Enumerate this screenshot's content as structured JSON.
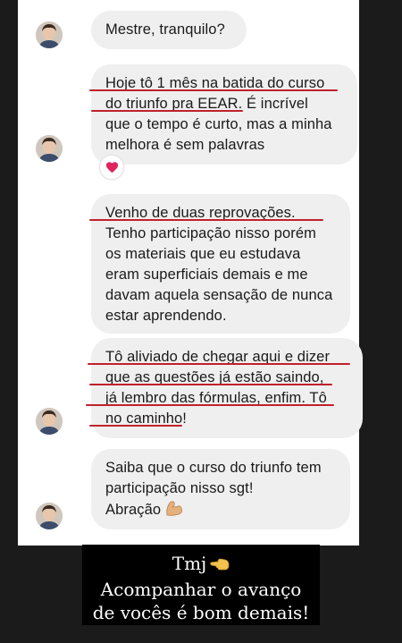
{
  "messages": [
    {
      "lines": [
        "Mestre, tranquilo?"
      ]
    },
    {
      "lines": [
        "Hoje tô 1 mês na batida do curso",
        "do triunfo pra EEAR. É incrível",
        "que o tempo é curto, mas a minha",
        "melhora é sem palavras"
      ],
      "reaction": "heart-icon"
    },
    {
      "lines": [
        "Venho de duas reprovações.",
        "Tenho participação nisso porém",
        "os materiais que eu estudava",
        "eram superficiais demais e me",
        "davam aquela sensação de nunca",
        "estar aprendendo."
      ]
    },
    {
      "lines": [
        "Tô aliviado de chegar aqui e dizer",
        "que as questões já estão saindo,",
        "já lembro das fórmulas, enfim. Tô",
        "no caminho!"
      ]
    },
    {
      "lines": [
        "Saiba que o curso do triunfo tem",
        "participação nisso sgt!",
        "Abração"
      ],
      "emoji": "flexed-biceps-icon"
    }
  ],
  "caption": {
    "line1": "Tmj",
    "line2": "Acompanhar o avanço",
    "line3": "de vocês é bom demais!",
    "emoji": "backhand-index-pointing-left-icon"
  },
  "colors": {
    "background": "#1b1b1b",
    "card": "#ffffff",
    "bubble": "#efefef",
    "underline": "#c0212c",
    "heart": "#e0245e",
    "caption_bg": "#000000"
  }
}
